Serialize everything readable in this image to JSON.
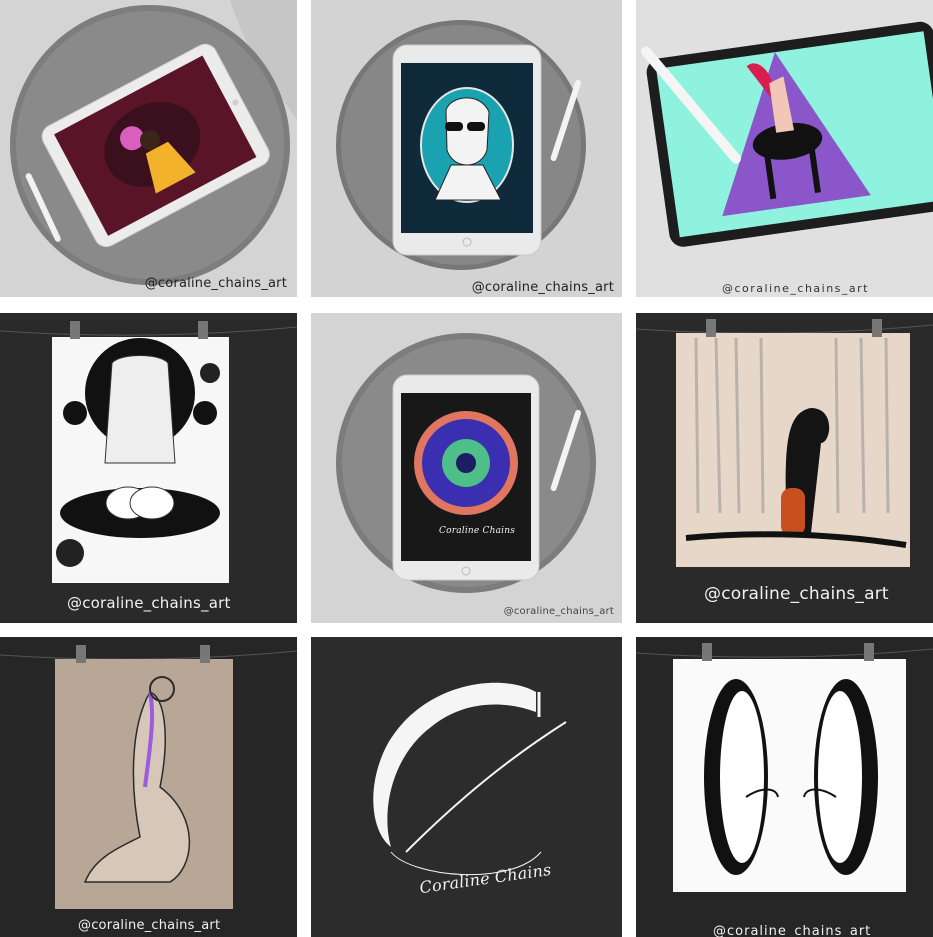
{
  "gallery": {
    "watermark": "@coraline_chains_art",
    "watermark_spaced": "@coraline_chains_art",
    "logo_script": "Coraline Chains",
    "tablet_signature": "Coraline Chains"
  },
  "colors": {
    "light_bg": "#d6d6d6",
    "dark_bg": "#2b2b2b",
    "tablet_silver": "#e9e9ea",
    "teal": "#1aa2b0",
    "mint": "#8ff2de",
    "purple": "#8a56c9"
  },
  "icons": {
    "pencil": "apple-pencil",
    "clip": "binder-clip"
  }
}
